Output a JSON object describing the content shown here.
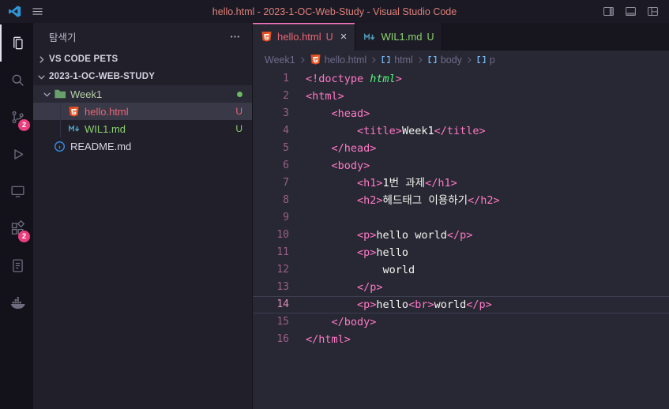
{
  "window": {
    "title": "hello.html - 2023-1-OC-Web-Study - Visual Studio Code",
    "controls": [
      "toggle-sidebar",
      "toggle-panel",
      "customize-layout"
    ]
  },
  "activity_bar": [
    {
      "name": "explorer",
      "icon": "files",
      "active": true
    },
    {
      "name": "search",
      "icon": "search",
      "active": false
    },
    {
      "name": "source-control",
      "icon": "source-control",
      "active": false,
      "badge": "2"
    },
    {
      "name": "run-and-debug",
      "icon": "run",
      "active": false
    },
    {
      "name": "remote-explorer",
      "icon": "monitor",
      "active": false
    },
    {
      "name": "extensions",
      "icon": "extensions",
      "active": false,
      "badge": "2"
    },
    {
      "name": "notebook",
      "icon": "notebook",
      "active": false
    },
    {
      "name": "docker",
      "icon": "docker",
      "active": false
    }
  ],
  "sidebar": {
    "title": "탐색기",
    "sections": [
      {
        "label": "VS CODE PETS",
        "collapsed": true
      },
      {
        "label": "2023-1-OC-WEB-STUDY",
        "collapsed": false
      }
    ],
    "files": [
      {
        "label": "Week1",
        "kind": "folder",
        "depth": 0,
        "expanded": true,
        "highlighted": true,
        "color_key": "folder",
        "indicator": "dot"
      },
      {
        "label": "hello.html",
        "kind": "html",
        "depth": 1,
        "badge": "U",
        "color_key": "red",
        "selected": true
      },
      {
        "label": "WIL1.md",
        "kind": "markdown",
        "depth": 1,
        "badge": "U",
        "color_key": "green"
      },
      {
        "label": "README.md",
        "kind": "readme",
        "depth": 0,
        "color_key": "default"
      }
    ]
  },
  "editor_tabs": [
    {
      "label": "hello.html",
      "badge": "U",
      "icon": "html",
      "active": true,
      "color_key": "red",
      "close_glyph": "×"
    },
    {
      "label": "WIL1.md",
      "badge": "U",
      "icon": "markdown",
      "active": false,
      "color_key": "green"
    }
  ],
  "breadcrumbs": [
    {
      "label": "Week1"
    },
    {
      "label": "hello.html",
      "icon": "html"
    },
    {
      "label": "html",
      "icon": "symbol"
    },
    {
      "label": "body",
      "icon": "symbol"
    },
    {
      "label": "p",
      "icon": "symbol"
    }
  ],
  "editor": {
    "active_line": 14,
    "lines": [
      {
        "n": 1,
        "tokens": [
          [
            "tag",
            "<!doctype "
          ],
          [
            "em",
            "html"
          ],
          [
            "tag",
            ">"
          ]
        ]
      },
      {
        "n": 2,
        "tokens": [
          [
            "tag",
            "<html>"
          ]
        ]
      },
      {
        "n": 3,
        "tokens": [
          [
            "text",
            "    "
          ],
          [
            "tag",
            "<head>"
          ]
        ]
      },
      {
        "n": 4,
        "tokens": [
          [
            "text",
            "        "
          ],
          [
            "tag",
            "<title>"
          ],
          [
            "text",
            "Week1"
          ],
          [
            "tag",
            "</title>"
          ]
        ]
      },
      {
        "n": 5,
        "tokens": [
          [
            "text",
            "    "
          ],
          [
            "tag",
            "</head>"
          ]
        ]
      },
      {
        "n": 6,
        "tokens": [
          [
            "text",
            "    "
          ],
          [
            "tag",
            "<body>"
          ]
        ]
      },
      {
        "n": 7,
        "tokens": [
          [
            "text",
            "        "
          ],
          [
            "tag",
            "<h1>"
          ],
          [
            "text",
            "1번 과제"
          ],
          [
            "tag",
            "</h1>"
          ]
        ]
      },
      {
        "n": 8,
        "tokens": [
          [
            "text",
            "        "
          ],
          [
            "tag",
            "<h2>"
          ],
          [
            "text",
            "헤드태그 이용하기"
          ],
          [
            "tag",
            "</h2>"
          ]
        ]
      },
      {
        "n": 9,
        "tokens": []
      },
      {
        "n": 10,
        "tokens": [
          [
            "text",
            "        "
          ],
          [
            "tag",
            "<p>"
          ],
          [
            "text",
            "hello world"
          ],
          [
            "tag",
            "</p>"
          ]
        ]
      },
      {
        "n": 11,
        "tokens": [
          [
            "text",
            "        "
          ],
          [
            "tag",
            "<p>"
          ],
          [
            "text",
            "hello"
          ]
        ]
      },
      {
        "n": 12,
        "tokens": [
          [
            "text",
            "            "
          ],
          [
            "text",
            "world"
          ]
        ]
      },
      {
        "n": 13,
        "tokens": [
          [
            "text",
            "        "
          ],
          [
            "tag",
            "</p>"
          ]
        ]
      },
      {
        "n": 14,
        "tokens": [
          [
            "text",
            "        "
          ],
          [
            "tag",
            "<p>"
          ],
          [
            "text",
            "hello"
          ],
          [
            "tag",
            "<br>"
          ],
          [
            "text",
            "world"
          ],
          [
            "tag",
            "</p>"
          ]
        ]
      },
      {
        "n": 15,
        "tokens": [
          [
            "text",
            "    "
          ],
          [
            "tag",
            "</body>"
          ]
        ]
      },
      {
        "n": 16,
        "tokens": [
          [
            "tag",
            "</html>"
          ]
        ]
      }
    ]
  },
  "colors": {
    "accent_pink": "#ff79c6",
    "tag": "#ff79c6",
    "text": "#f6f6f2",
    "doctype_value": "#50fa7b",
    "file_red": "#ee6473",
    "file_green": "#8bd16e",
    "file_default": "#d8d6e4",
    "folder_label": "#b7d0a8",
    "badge_bg": "#ea3e7e",
    "title_fg": "#de8079",
    "line_number": "#9b5f86",
    "line_number_active": "#df8cba",
    "breadcrumb_fg": "#6f6a8a",
    "git_dot": "#6db95f",
    "html_icon": "#e44d26",
    "markdown_icon": "#519aba",
    "readme_icon": "#3b8eea",
    "folder_icon": "#699f6a"
  }
}
